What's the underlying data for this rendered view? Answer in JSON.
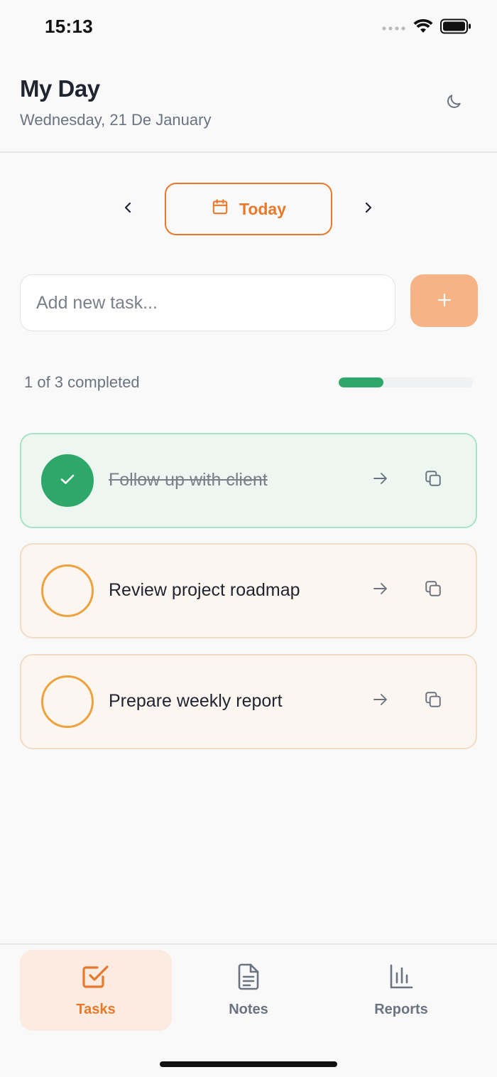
{
  "status_bar": {
    "time": "15:13",
    "icons": [
      "signal-icon",
      "wifi-icon",
      "battery-icon"
    ]
  },
  "header": {
    "title": "My Day",
    "date": "Wednesday, 21 De January",
    "theme_icon": "moon-icon"
  },
  "date_nav": {
    "prev_icon": "chevron-left-icon",
    "today_label": "Today",
    "today_icon": "calendar-icon",
    "next_icon": "chevron-right-icon"
  },
  "add_task": {
    "placeholder": "Add new task...",
    "value": "",
    "button_icon": "plus-icon"
  },
  "progress": {
    "text": "1 of 3 completed",
    "completed": 1,
    "total": 3
  },
  "tasks": [
    {
      "label": "Follow up with client",
      "completed": true
    },
    {
      "label": "Review project roadmap",
      "completed": false
    },
    {
      "label": "Prepare weekly report",
      "completed": false
    }
  ],
  "bottom_nav": {
    "tabs": [
      {
        "label": "Tasks",
        "icon": "checkbox-icon",
        "active": true
      },
      {
        "label": "Notes",
        "icon": "document-icon",
        "active": false
      },
      {
        "label": "Reports",
        "icon": "bar-chart-icon",
        "active": false
      }
    ]
  },
  "colors": {
    "accent": "#e8782a",
    "success": "#2ea86a",
    "add_button": "#f6b386",
    "pending_ring": "#eda23f"
  }
}
